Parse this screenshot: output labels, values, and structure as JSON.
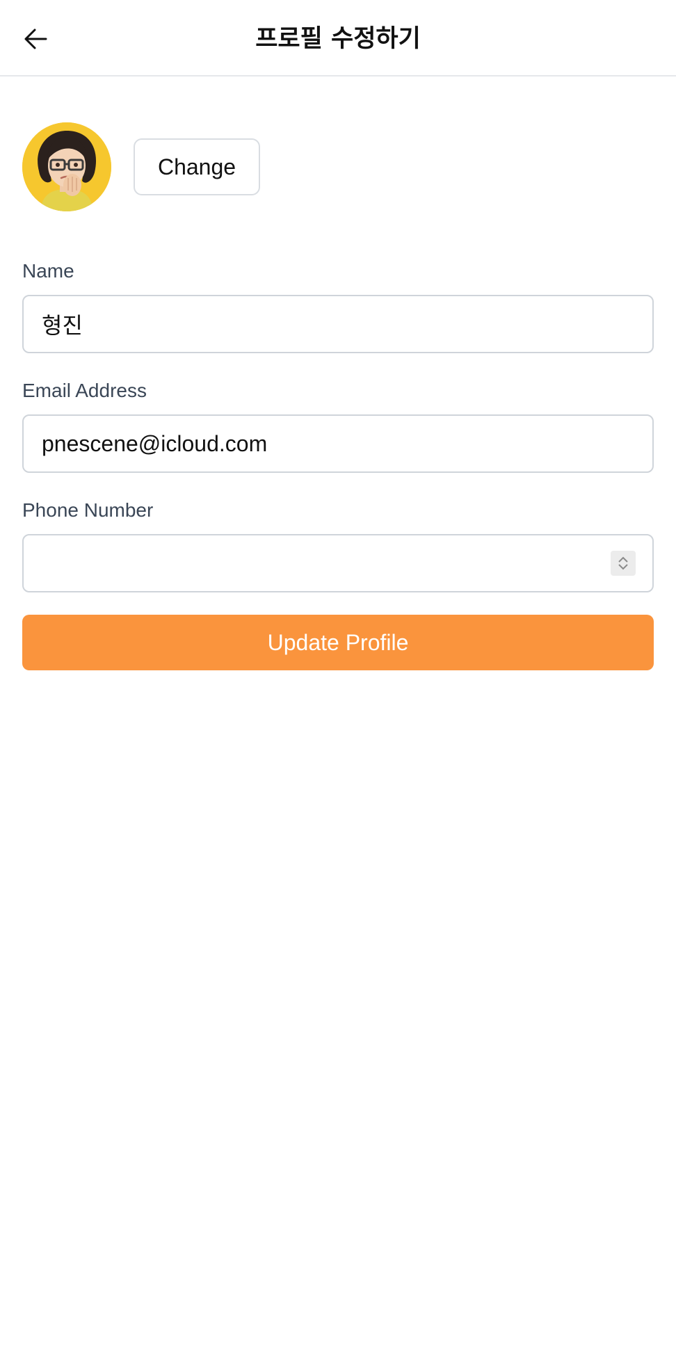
{
  "header": {
    "title": "프로필 수정하기",
    "back_icon": "arrow-left-icon"
  },
  "profile": {
    "avatar_icon": "memoji-avatar",
    "change_label": "Change"
  },
  "form": {
    "name": {
      "label": "Name",
      "value": "형진"
    },
    "email": {
      "label": "Email Address",
      "value": "pnescene@icloud.com"
    },
    "phone": {
      "label": "Phone Number",
      "value": ""
    }
  },
  "actions": {
    "update_label": "Update Profile"
  },
  "colors": {
    "accent": "#fa943d",
    "label_text": "#3a4656",
    "border": "#cfd4da"
  }
}
